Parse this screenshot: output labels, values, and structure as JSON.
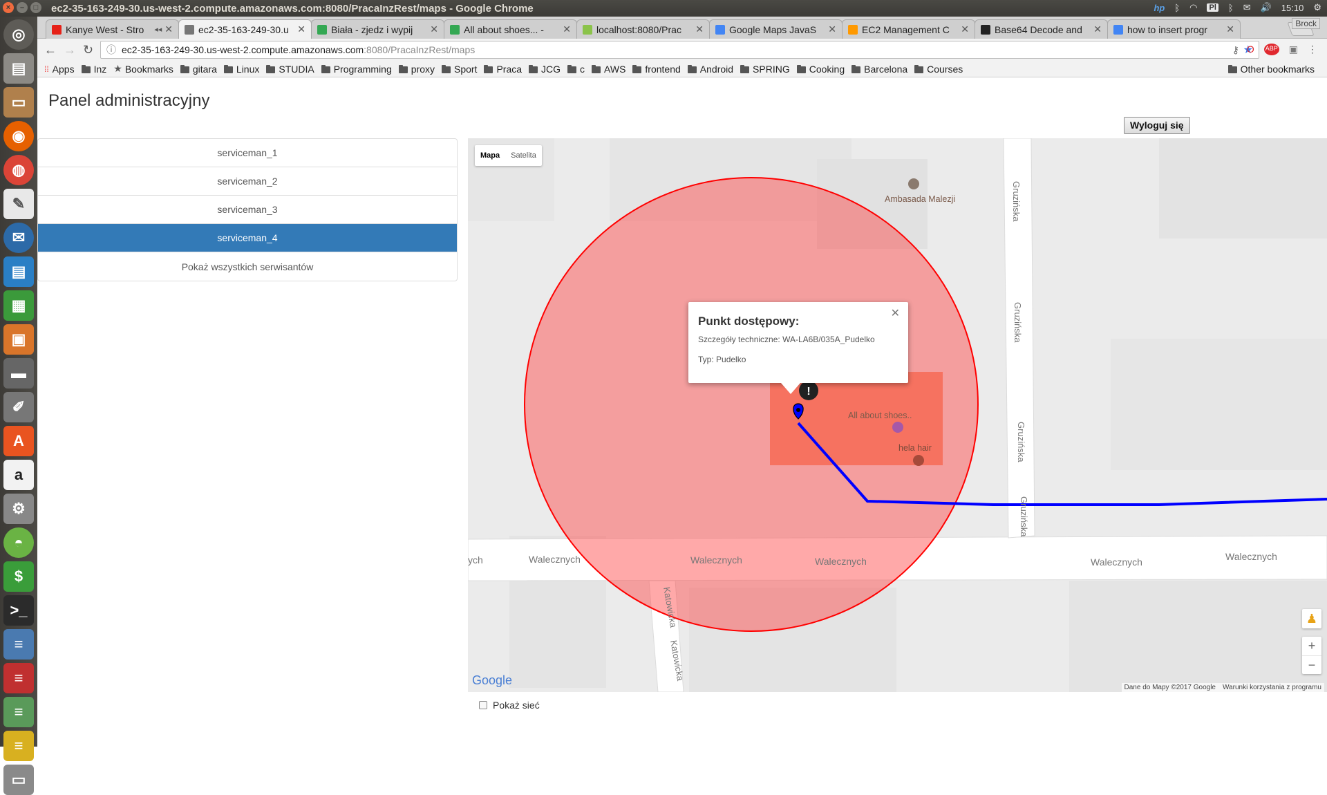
{
  "window": {
    "title": "ec2-35-163-249-30.us-west-2.compute.amazonaws.com:8080/PracaInzRest/maps - Google Chrome"
  },
  "tray": {
    "keyboard": "Pl",
    "clock": "15:10"
  },
  "tabs": [
    {
      "title": "Kanye West - Stro",
      "color": "#e62117",
      "active": false
    },
    {
      "title": "ec2-35-163-249-30.u",
      "color": "#777777",
      "active": true
    },
    {
      "title": "Biała - zjedz i wypij",
      "color": "#34a853",
      "active": false
    },
    {
      "title": "All about shoes... -",
      "color": "#34a853",
      "active": false
    },
    {
      "title": "localhost:8080/Prac",
      "color": "#8bc34a",
      "active": false
    },
    {
      "title": "Google Maps JavaS",
      "color": "#4285f4",
      "active": false
    },
    {
      "title": "EC2 Management C",
      "color": "#f90",
      "active": false
    },
    {
      "title": "Base64 Decode and",
      "color": "#222222",
      "active": false
    },
    {
      "title": "how to insert progr",
      "color": "#4285f4",
      "active": false
    }
  ],
  "profile": "Brock",
  "address": {
    "host": "ec2-35-163-249-30.us-west-2.compute.amazonaws.com",
    "path": ":8080/PracaInzRest/maps"
  },
  "bookmarks": [
    "Apps",
    "Inz",
    "Bookmarks",
    "gitara",
    "Linux",
    "STUDIA",
    "Programming",
    "proxy",
    "Sport",
    "Praca",
    "JCG",
    "c",
    "AWS",
    "frontend",
    "Android",
    "SPRING",
    "Cooking",
    "Barcelona",
    "Courses"
  ],
  "other_bookmarks": "Other bookmarks",
  "page": {
    "title": "Panel administracyjny",
    "logout": "Wyloguj się",
    "servicemen": [
      {
        "label": "serviceman_1",
        "active": false
      },
      {
        "label": "serviceman_2",
        "active": false
      },
      {
        "label": "serviceman_3",
        "active": false
      },
      {
        "label": "serviceman_4",
        "active": true
      },
      {
        "label": "Pokaż wszystkich serwisantów",
        "active": false
      }
    ],
    "show_network": "Pokaż sieć"
  },
  "map": {
    "types": [
      "Mapa",
      "Satelita"
    ],
    "infowindow": {
      "title": "Punkt dostępowy:",
      "details": "Szczegóły techniczne: WA-LA6B/035A_Pudelko",
      "type": "Typ: Pudelko"
    },
    "labels": {
      "embassy": "Ambasada Malezji",
      "shoes": "All about shoes..",
      "hair": "hela hair",
      "street_w": "Walecznych",
      "street_g": "Gruzińska",
      "street_k": "Katowicka",
      "street_w_partial": "ych"
    },
    "logo": "Google",
    "credits": [
      "Dane do Mapy ©2017 Google",
      "Warunki korzystania z programu"
    ],
    "colors": {
      "circle": "#f08080",
      "route": "#0000ff"
    }
  }
}
